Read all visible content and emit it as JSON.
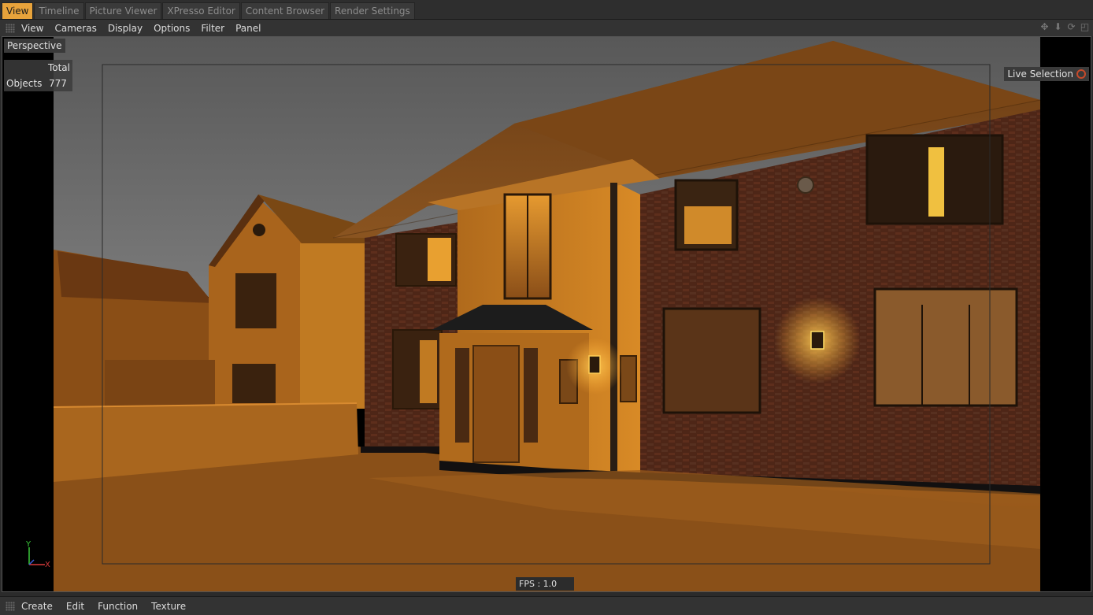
{
  "tabs": [
    {
      "label": "View",
      "active": true
    },
    {
      "label": "Timeline",
      "active": false
    },
    {
      "label": "Picture Viewer",
      "active": false
    },
    {
      "label": "XPresso Editor",
      "active": false
    },
    {
      "label": "Content Browser",
      "active": false
    },
    {
      "label": "Render Settings",
      "active": false
    }
  ],
  "viewport_menu": [
    "View",
    "Cameras",
    "Display",
    "Options",
    "Filter",
    "Panel"
  ],
  "viewport_icons": [
    "move-icon",
    "down-arrow-icon",
    "rotate-icon",
    "maximize-icon"
  ],
  "viewport": {
    "camera_label": "Perspective",
    "stats": {
      "total_label": "Total",
      "objects_label": "Objects",
      "objects_value": "777"
    },
    "tool_label": "Live Selection",
    "fps_text": "FPS : 1.0",
    "axis": {
      "y": "Y",
      "x": "X"
    }
  },
  "bottom_menu": [
    "Create",
    "Edit",
    "Function",
    "Texture"
  ],
  "colors": {
    "active_tab": "#e8a33b",
    "brick": "#5a2e1c",
    "render_orange": "#c87a1e"
  }
}
